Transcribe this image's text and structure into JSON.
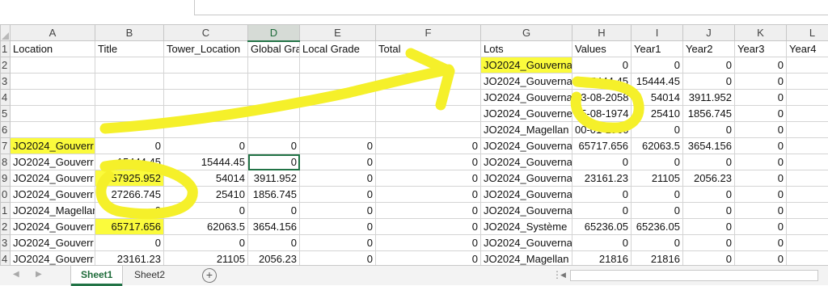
{
  "columns": [
    {
      "letter": "A",
      "header": "Location",
      "selected": false
    },
    {
      "letter": "B",
      "header": "Title",
      "selected": false
    },
    {
      "letter": "C",
      "header": "Tower_Location",
      "selected": false
    },
    {
      "letter": "D",
      "header": "Global Gra",
      "selected": true
    },
    {
      "letter": "E",
      "header": "Local Grade",
      "selected": false
    },
    {
      "letter": "F",
      "header": "Total",
      "selected": false
    },
    {
      "letter": "G",
      "header": "Lots",
      "selected": false
    },
    {
      "letter": "H",
      "header": "Values",
      "selected": false
    },
    {
      "letter": "I",
      "header": "Year1",
      "selected": false
    },
    {
      "letter": "J",
      "header": "Year2",
      "selected": false
    },
    {
      "letter": "K",
      "header": "Year3",
      "selected": false
    },
    {
      "letter": "L",
      "header": "Year4",
      "selected": false
    }
  ],
  "rows": [
    {
      "num": "1",
      "cells": [
        "Location",
        "Title",
        "Tower_Location",
        "Global Gra",
        "Local Grade",
        "Total",
        "Lots",
        "Values",
        "Year1",
        "Year2",
        "Year3",
        "Year4"
      ]
    },
    {
      "num": "2",
      "cells": [
        "",
        "",
        "",
        "",
        "",
        "",
        "JO2024_Gouverna",
        "0",
        "0",
        "0",
        "0",
        ""
      ]
    },
    {
      "num": "3",
      "cells": [
        "",
        "",
        "",
        "",
        "",
        "",
        "JO2024_Gouverna",
        "15444.45",
        "15444.45",
        "0",
        "0",
        ""
      ]
    },
    {
      "num": "4",
      "cells": [
        "",
        "",
        "",
        "",
        "",
        "",
        "JO2024_Gouverna",
        "03-08-2058",
        "54014",
        "3911.952",
        "0",
        ""
      ]
    },
    {
      "num": "5",
      "cells": [
        "",
        "",
        "",
        "",
        "",
        "",
        "JO2024_Gouverne",
        "25-08-1974",
        "25410",
        "1856.745",
        "0",
        ""
      ]
    },
    {
      "num": "6",
      "cells": [
        "",
        "",
        "",
        "",
        "",
        "",
        "JO2024_Magellan",
        "00-01-1900",
        "0",
        "0",
        "0",
        ""
      ]
    },
    {
      "num": "7",
      "cells": [
        "JO2024_Gouverr",
        "0",
        "0",
        "0",
        "0",
        "0",
        "JO2024_Gouverna",
        "65717.656",
        "62063.5",
        "3654.156",
        "0",
        ""
      ]
    },
    {
      "num": "8",
      "cells": [
        "JO2024_Gouverr",
        "15444.45",
        "15444.45",
        "0",
        "0",
        "0",
        "JO2024_Gouverna",
        "0",
        "0",
        "0",
        "0",
        ""
      ]
    },
    {
      "num": "9",
      "cells": [
        "JO2024_Gouverr",
        "57925.952",
        "54014",
        "3911.952",
        "0",
        "0",
        "JO2024_Gouverna",
        "23161.23",
        "21105",
        "2056.23",
        "0",
        ""
      ]
    },
    {
      "num": "0",
      "cells": [
        "JO2024_Gouverr",
        "27266.745",
        "25410",
        "1856.745",
        "0",
        "0",
        "JO2024_Gouverna",
        "0",
        "0",
        "0",
        "0",
        ""
      ]
    },
    {
      "num": "1",
      "cells": [
        "JO2024_Magellar",
        "0",
        "0",
        "0",
        "0",
        "0",
        "JO2024_Gouverna",
        "0",
        "0",
        "0",
        "0",
        ""
      ]
    },
    {
      "num": "2",
      "cells": [
        "JO2024_Gouverr",
        "65717.656",
        "62063.5",
        "3654.156",
        "0",
        "0",
        "JO2024_Système",
        "65236.05",
        "65236.05",
        "0",
        "0",
        ""
      ]
    },
    {
      "num": "3",
      "cells": [
        "JO2024_Gouverr",
        "0",
        "0",
        "0",
        "0",
        "0",
        "JO2024_Gouverna",
        "0",
        "0",
        "0",
        "0",
        ""
      ]
    },
    {
      "num": "4",
      "cells": [
        "JO2024_Gouverr",
        "23161.23",
        "21105",
        "2056.23",
        "0",
        "0",
        "JO2024_Magellan",
        "21816",
        "21816",
        "0",
        "0",
        ""
      ]
    }
  ],
  "highlight_color": "#fbfb3c",
  "active_cell": "D8",
  "sheet_tabs": [
    {
      "label": "Sheet1",
      "active": true
    },
    {
      "label": "Sheet2",
      "active": false
    }
  ],
  "scroll_dots": "⋮",
  "add_sheet_symbol": "+"
}
